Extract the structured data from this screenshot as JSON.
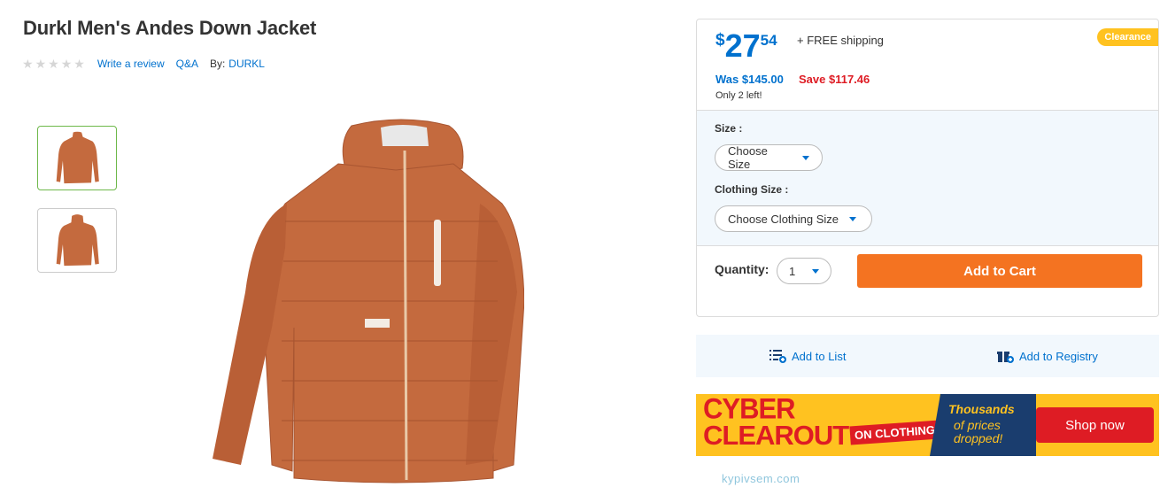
{
  "product": {
    "title": "Durkl Men's Andes Down Jacket",
    "write_review": "Write a review",
    "qa": "Q&A",
    "by_label": "By:",
    "brand": "DURKL",
    "rating_stars": 0,
    "rating_max": 5,
    "jacket_color": "#c46a3e"
  },
  "thumbnails": [
    {
      "view": "front"
    },
    {
      "view": "back"
    }
  ],
  "buybox": {
    "currency": "$",
    "price_dollars": "27",
    "price_cents": "54",
    "shipping": "+ FREE shipping",
    "badge": "Clearance",
    "was": "Was $145.00",
    "save": "Save $117.46",
    "stock": "Only 2 left!",
    "size_label": "Size :",
    "size_choice": "Choose Size",
    "clothing_size_label": "Clothing Size :",
    "clothing_size_choice": "Choose Clothing Size",
    "quantity_label": "Quantity:",
    "quantity_value": "1",
    "add_to_cart": "Add to Cart"
  },
  "actions": {
    "add_to_list": "Add to List",
    "add_to_registry": "Add to Registry"
  },
  "banner": {
    "line1": "CYBER",
    "line2": "CLEAROUT",
    "tag": "ON CLOTHING",
    "thousands": "Thousands",
    "prices": "of prices dropped!",
    "cta": "Shop now"
  },
  "watermark": "kypivsem.com",
  "colors": {
    "accent_blue": "#0071ce",
    "cart_orange": "#f47321",
    "save_red": "#de1c24",
    "badge_yellow": "#ffc220"
  }
}
